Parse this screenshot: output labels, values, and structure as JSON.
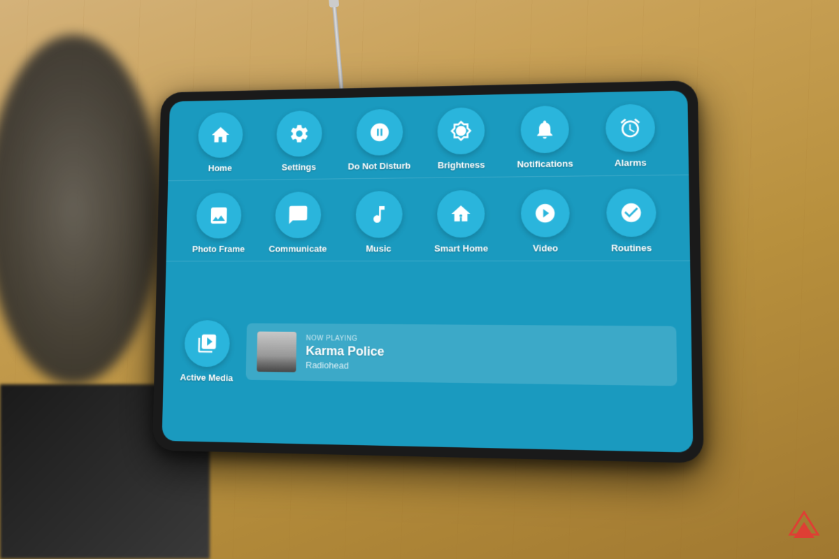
{
  "background": {
    "color": "#c8a96e"
  },
  "device": {
    "screen_bg": "#1a9abf"
  },
  "rows": [
    {
      "id": "row1",
      "items": [
        {
          "id": "home",
          "label": "Home",
          "icon": "home"
        },
        {
          "id": "settings",
          "label": "Settings",
          "icon": "settings"
        },
        {
          "id": "do-not-disturb",
          "label": "Do Not Disturb",
          "icon": "do-not-disturb"
        },
        {
          "id": "brightness",
          "label": "Brightness",
          "icon": "brightness"
        },
        {
          "id": "notifications",
          "label": "Notifications",
          "icon": "notifications"
        },
        {
          "id": "alarms",
          "label": "Alarms",
          "icon": "alarms"
        }
      ]
    },
    {
      "id": "row2",
      "items": [
        {
          "id": "photo-frame",
          "label": "Photo Frame",
          "icon": "photo-frame"
        },
        {
          "id": "communicate",
          "label": "Communicate",
          "icon": "communicate"
        },
        {
          "id": "music",
          "label": "Music",
          "icon": "music"
        },
        {
          "id": "smart-home",
          "label": "Smart Home",
          "icon": "smart-home"
        },
        {
          "id": "video",
          "label": "Video",
          "icon": "video"
        },
        {
          "id": "routines",
          "label": "Routines",
          "icon": "routines"
        }
      ]
    }
  ],
  "now_playing": {
    "label": "NOW PLAYING",
    "title": "Karma Police",
    "artist": "Radiohead",
    "active_media_label": "Active Media"
  }
}
